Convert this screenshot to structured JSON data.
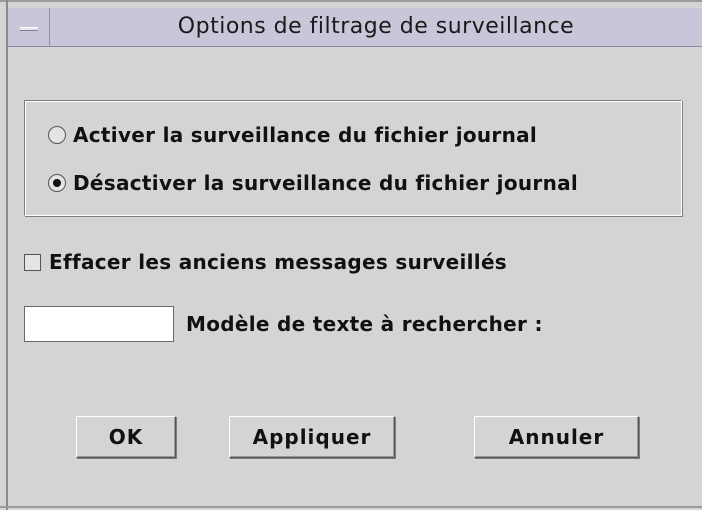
{
  "window": {
    "title": "Options de filtrage de surveillance"
  },
  "monitoring_mode": {
    "options": [
      {
        "label": "Activer la surveillance du fichier journal",
        "selected": false
      },
      {
        "label": "Désactiver la surveillance du fichier journal",
        "selected": true
      }
    ]
  },
  "clear_old": {
    "label": "Effacer les anciens messages surveillés",
    "checked": false
  },
  "search_pattern": {
    "value": "",
    "label": "Modèle de texte à rechercher :"
  },
  "buttons": {
    "ok": "OK",
    "apply": "Appliquer",
    "cancel": "Annuler"
  },
  "colors": {
    "background": "#d4d4d4",
    "titlebar": "#c8c6d8"
  },
  "icons": {
    "window_menu": "window-menu-icon"
  }
}
